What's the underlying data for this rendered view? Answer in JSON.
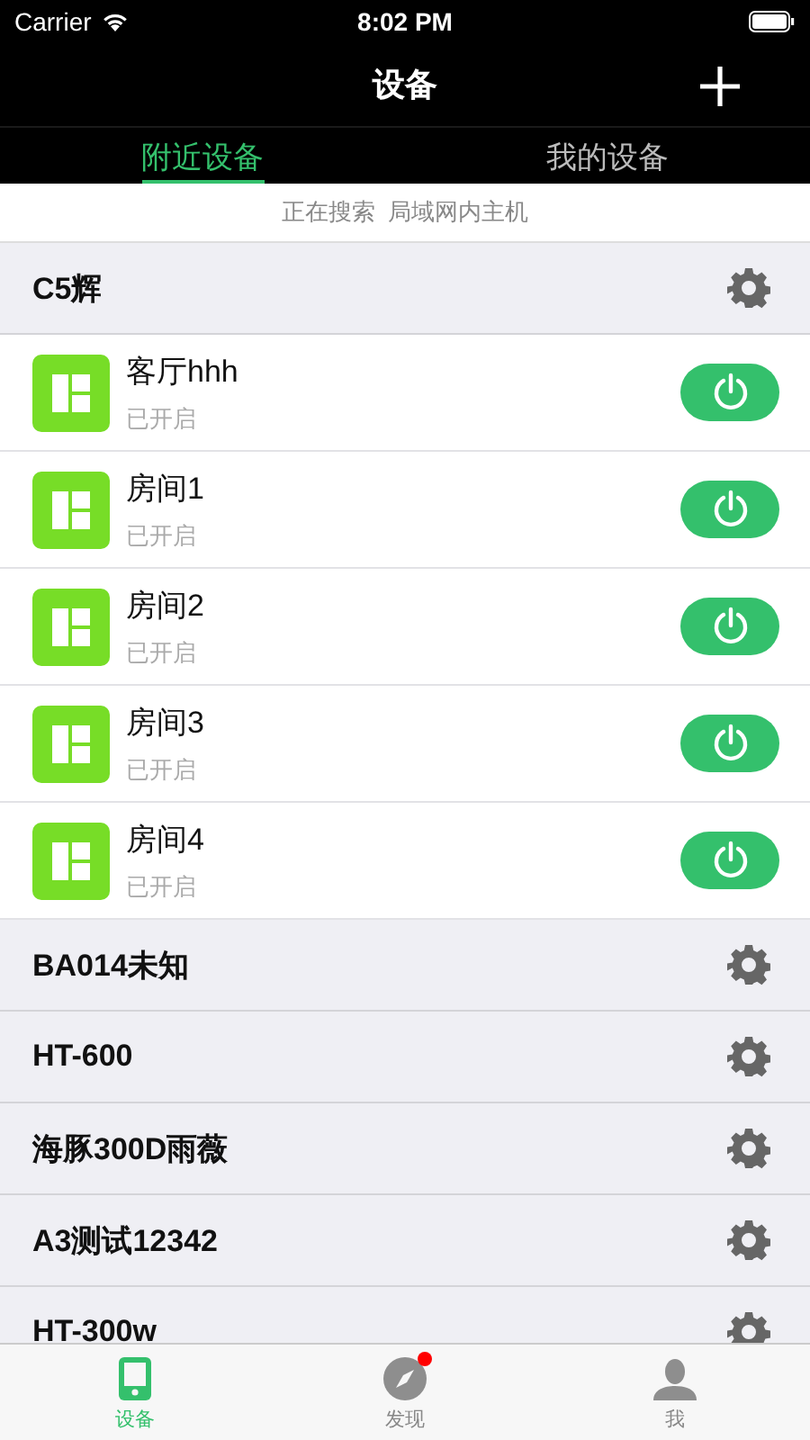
{
  "status_bar": {
    "carrier": "Carrier",
    "time": "8:02 PM"
  },
  "nav": {
    "title": "设备"
  },
  "tabs": [
    {
      "label": "附近设备",
      "selected": true
    },
    {
      "label": "我的设备",
      "selected": false
    }
  ],
  "search_status": "正在搜索  局域网内主机",
  "groups": [
    {
      "name": "C5辉",
      "devices": [
        {
          "name": "客厅hhh",
          "status": "已开启",
          "on": true
        },
        {
          "name": "房间1",
          "status": "已开启",
          "on": true
        },
        {
          "name": "房间2",
          "status": "已开启",
          "on": true
        },
        {
          "name": "房间3",
          "status": "已开启",
          "on": true
        },
        {
          "name": "房间4",
          "status": "已开启",
          "on": true
        }
      ]
    },
    {
      "name": "BA014未知"
    },
    {
      "name": "HT-600"
    },
    {
      "name": "海豚300D雨薇"
    },
    {
      "name": "A3测试12342"
    },
    {
      "name": "HT-300w"
    }
  ],
  "tab_bar": [
    {
      "label": "设备",
      "kind": "phone",
      "selected": true,
      "badge": false
    },
    {
      "label": "发现",
      "kind": "compass",
      "selected": false,
      "badge": true
    },
    {
      "label": "我",
      "kind": "person",
      "selected": false,
      "badge": false
    }
  ]
}
